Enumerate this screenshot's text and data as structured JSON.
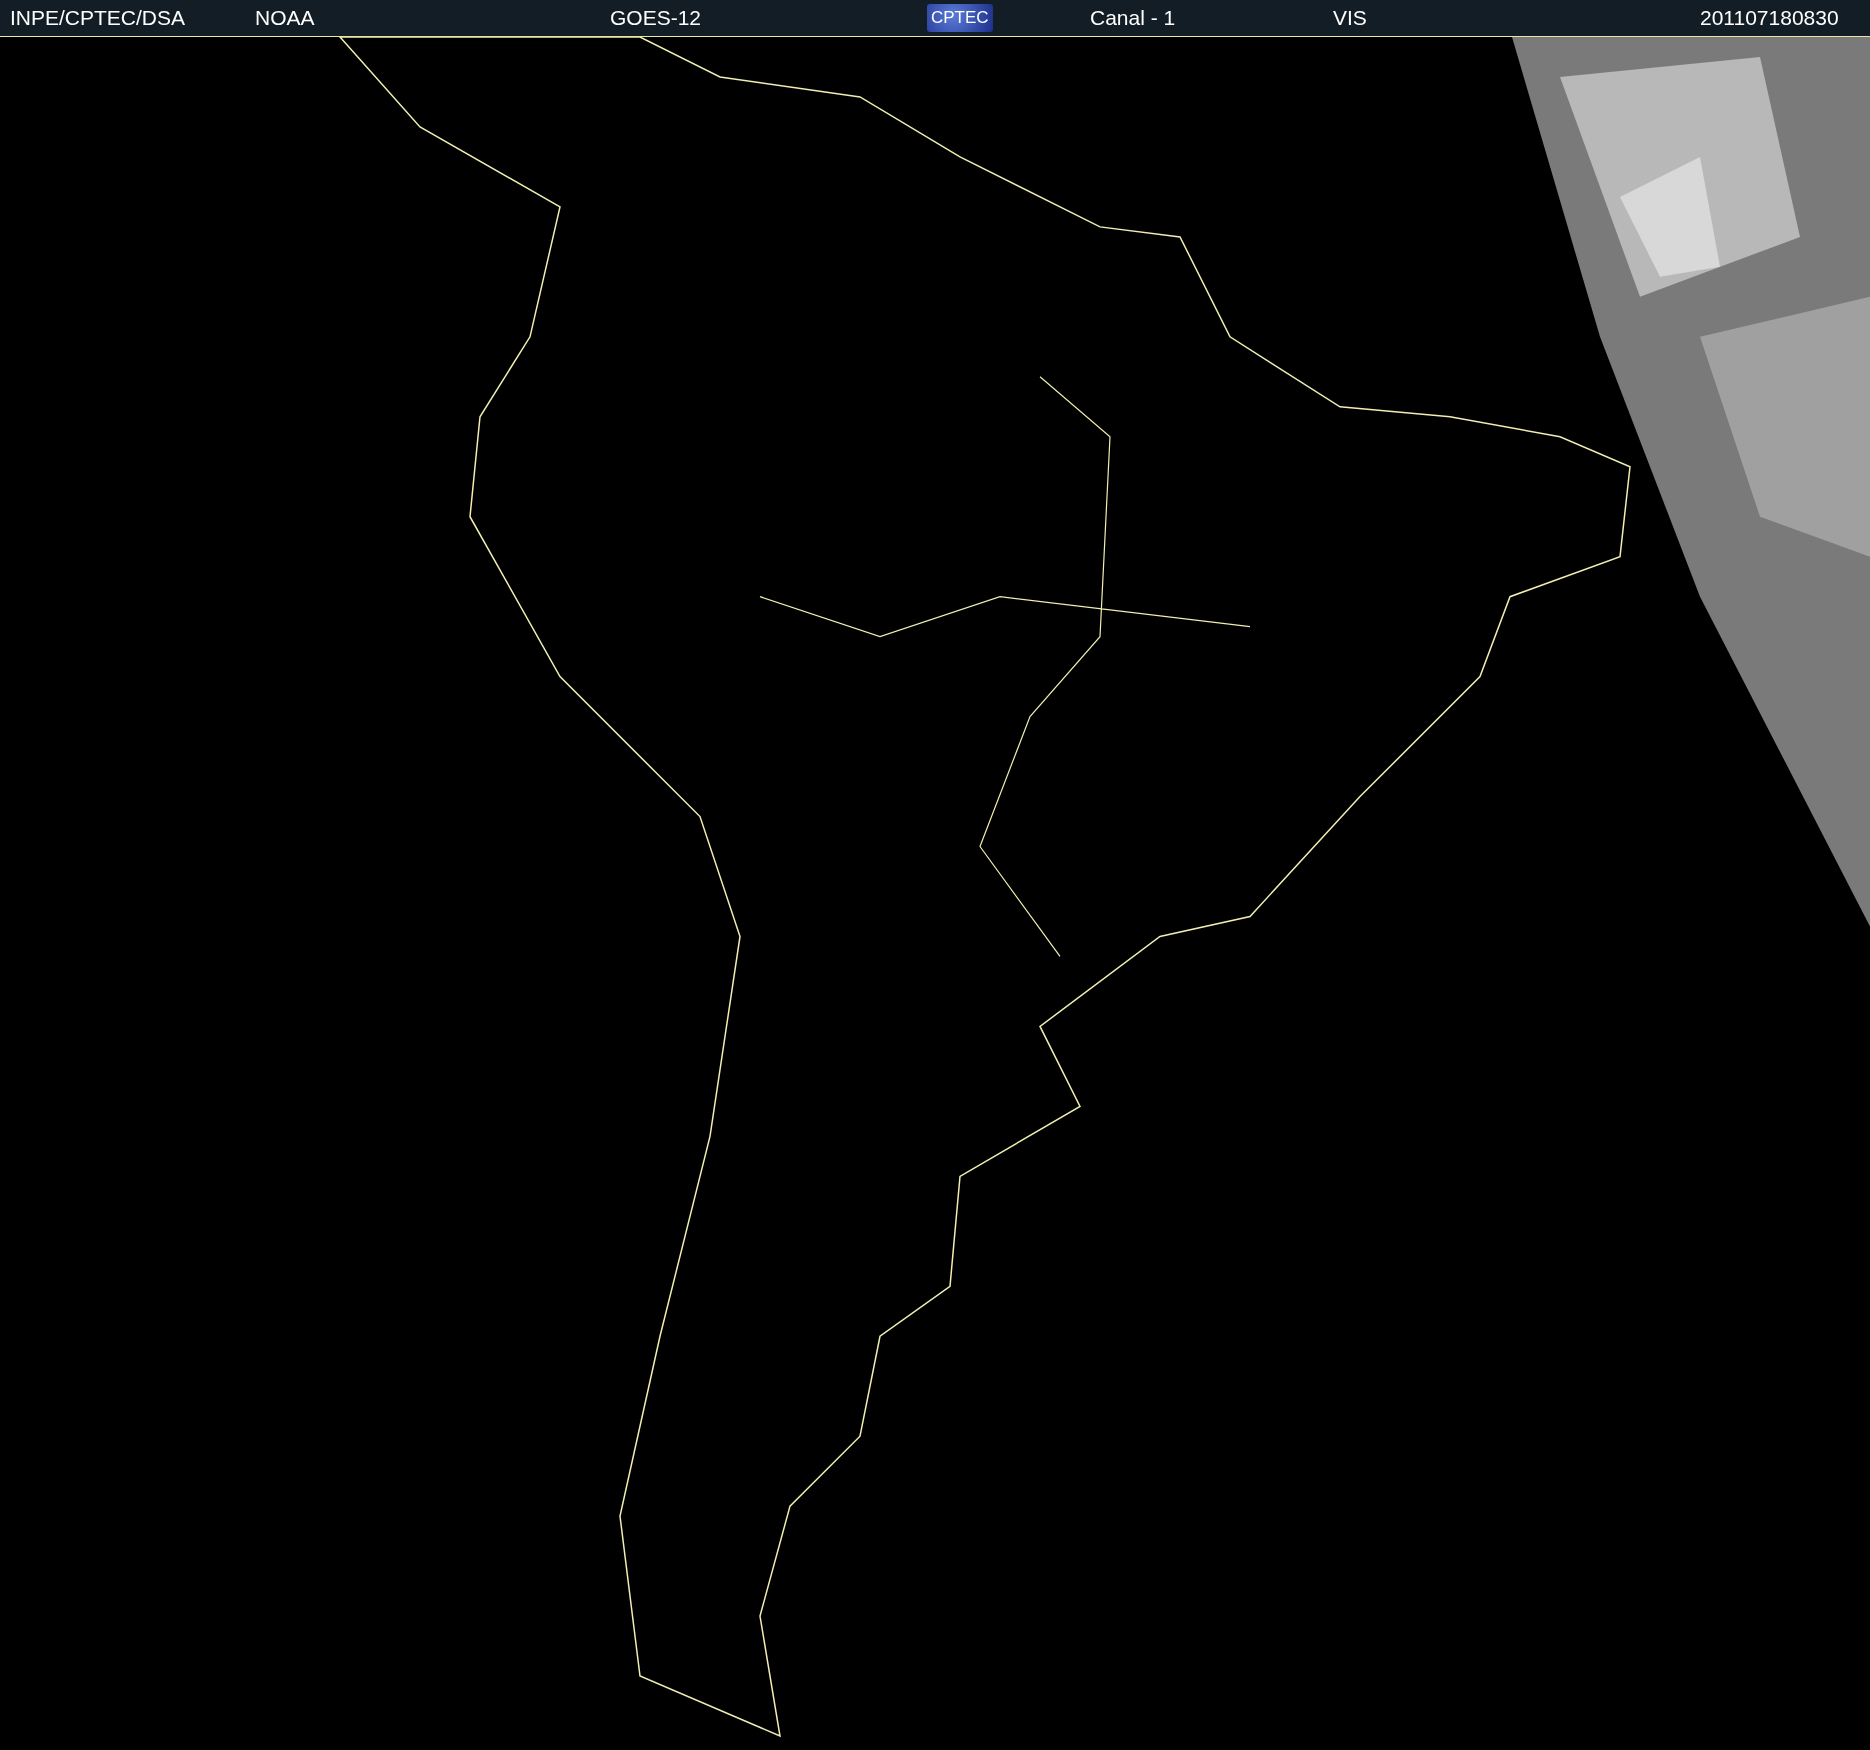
{
  "header": {
    "source": "INPE/CPTEC/DSA",
    "agency": "NOAA",
    "satellite": "GOES-12",
    "logo": "CPTEC",
    "channel": "Canal - 1",
    "band": "VIS",
    "timestamp": "201107180830"
  }
}
